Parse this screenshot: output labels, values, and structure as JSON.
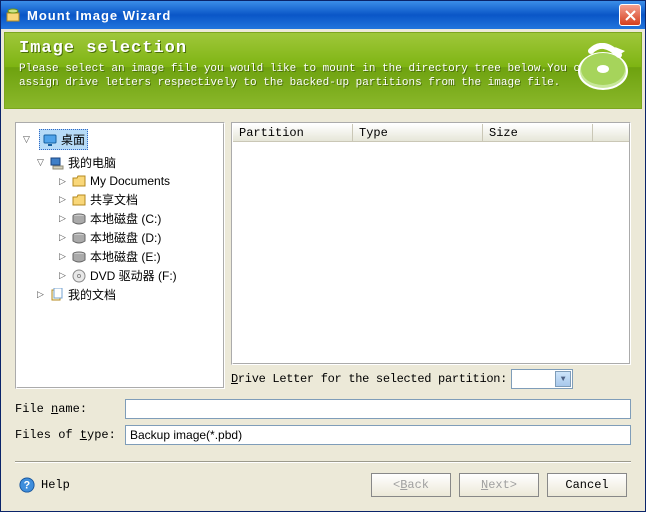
{
  "window": {
    "title": "Mount Image Wizard"
  },
  "banner": {
    "heading": "Image selection",
    "description": "Please select an image file you would like to mount in the directory tree below.You can assign drive letters respectively to the backed-up partitions from the image file."
  },
  "tree": {
    "root": "桌面",
    "my_computer": "我的电脑",
    "items": [
      {
        "label": "My Documents",
        "icon": "folder"
      },
      {
        "label": "共享文档",
        "icon": "folder"
      },
      {
        "label": "本地磁盘 (C:)",
        "icon": "disk"
      },
      {
        "label": "本地磁盘 (D:)",
        "icon": "disk"
      },
      {
        "label": "本地磁盘 (E:)",
        "icon": "disk"
      },
      {
        "label": "DVD 驱动器 (F:)",
        "icon": "dvd"
      }
    ],
    "my_documents": "我的文档"
  },
  "list": {
    "columns": {
      "partition": "Partition",
      "type": "Type",
      "size": "Size"
    }
  },
  "drive_letter_label": "Drive Letter for the selected partition:",
  "file_name_label": "File name:",
  "file_name_value": "",
  "files_of_type_label": "Files of type:",
  "files_of_type_value": "Backup image(*.pbd)",
  "footer": {
    "help": "Help",
    "back": "ack",
    "next": "ext",
    "cancel": "Cancel"
  }
}
